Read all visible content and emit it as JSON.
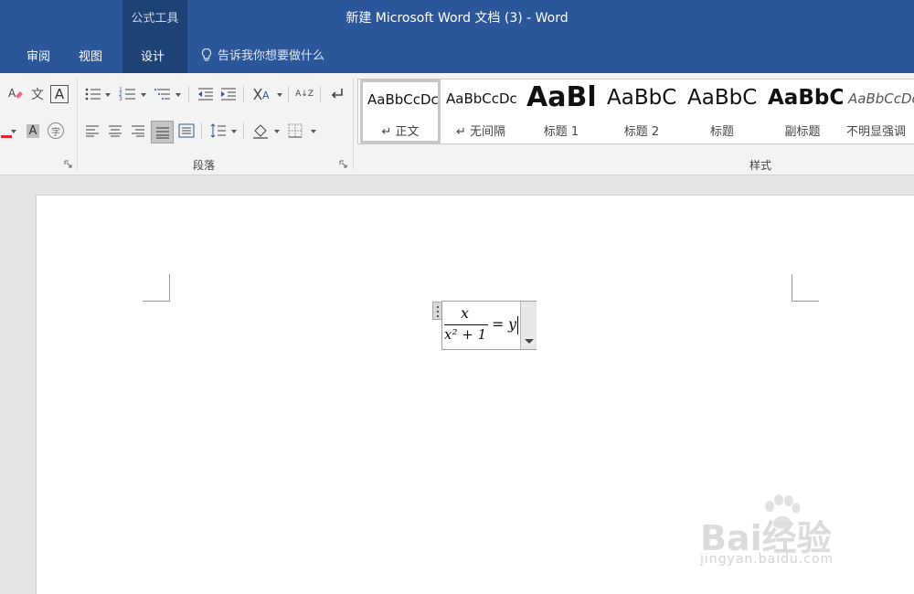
{
  "title_bar": {
    "context_tab_group": "公式工具",
    "document_title": "新建 Microsoft Word 文档 (3)  -  Word"
  },
  "tabs": [
    {
      "label": "审阅"
    },
    {
      "label": "视图"
    },
    {
      "label": "设计"
    }
  ],
  "tell_me": {
    "label": "告诉我你想要做什么",
    "icon": "lightbulb-icon"
  },
  "ribbon": {
    "groups": {
      "paragraph": {
        "label": "段落"
      },
      "styles": {
        "label": "样式"
      }
    },
    "styles_gallery": [
      {
        "preview": "AaBbCcDc",
        "name": "↵ 正文",
        "selected": true
      },
      {
        "preview": "AaBbCcDc",
        "name": "↵ 无间隔"
      },
      {
        "preview": "AaBl",
        "name": "标题 1"
      },
      {
        "preview": "AaBbC",
        "name": "标题 2"
      },
      {
        "preview": "AaBbC",
        "name": "标题"
      },
      {
        "preview": "AaBbC",
        "name": "副标题"
      },
      {
        "preview": "AaBbCcDc",
        "name": "不明显强调"
      }
    ],
    "icons": {
      "wen_glyph": "文",
      "char_border": "A",
      "char_shading": "A",
      "enclose_char": "字",
      "sort": "A↓Z"
    }
  },
  "equation": {
    "numerator": "x",
    "denominator": "x² + 1",
    "equals": "=",
    "rhs": "y"
  },
  "watermark": {
    "brand": "Bai经验",
    "url": "jingyan.baidu.com"
  },
  "colors": {
    "title_bar": "#2b579a",
    "context_group": "#1e4276",
    "ribbon_bg": "#f3f3f3",
    "font_color_red": "#e0262c"
  }
}
